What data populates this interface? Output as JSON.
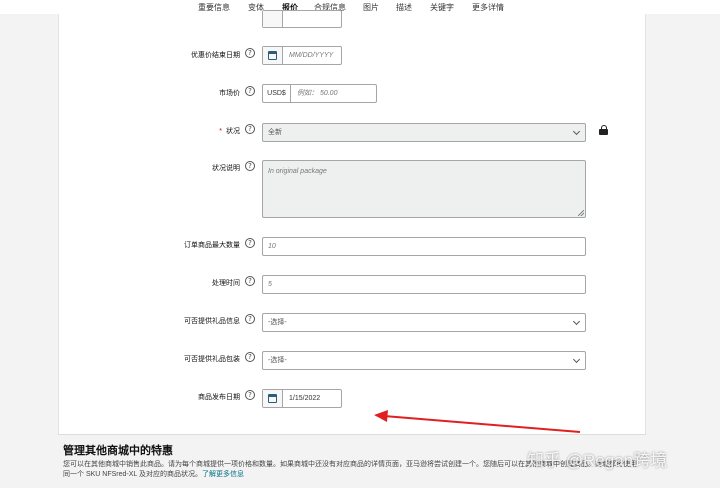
{
  "nav": {
    "tabs": [
      {
        "label": "重要信息"
      },
      {
        "label": "变体"
      },
      {
        "label": "报价"
      },
      {
        "label": "合规信息"
      },
      {
        "label": "图片"
      },
      {
        "label": "描述"
      },
      {
        "label": "关键字"
      },
      {
        "label": "更多详情"
      }
    ],
    "active": "报价"
  },
  "form": {
    "sale_end": {
      "label": "优惠价结束日期",
      "placeholder": "MM/DD/YYYY"
    },
    "list_price": {
      "label": "市场价",
      "currency": "USD$",
      "placeholder": "例如： 50.00"
    },
    "condition": {
      "required_mark": "*",
      "label": "状况",
      "value": "全新"
    },
    "condition_note": {
      "label": "状况说明",
      "placeholder": "In original package"
    },
    "max_order_qty": {
      "label": "订单商品最大数量",
      "placeholder": "10"
    },
    "handling_time": {
      "label": "处理时间",
      "placeholder": "5"
    },
    "gift_message": {
      "label": "可否提供礼品信息",
      "value": "-选择-"
    },
    "gift_wrap": {
      "label": "可否提供礼品包装",
      "value": "-选择-"
    },
    "release_date": {
      "label": "商品发布日期",
      "value": "1/15/2022"
    }
  },
  "bottom": {
    "title": "管理其他商城中的特惠",
    "text": "您可以在其他商城中销售此商品。请为每个商城提供一项价格和数量。如果商城中还没有对应商品的详情页面，亚马逊将尝试创建一个。您随后可以在其他商城中创建商品。商城都将使用同一个 SKU NFSred-XL 及对应的商品状况。",
    "link": "了解更多信息"
  },
  "watermark": "知乎 @Regan跨境",
  "colors": {
    "accent": "#008296",
    "arrow": "#e02020",
    "link": "#007185"
  }
}
